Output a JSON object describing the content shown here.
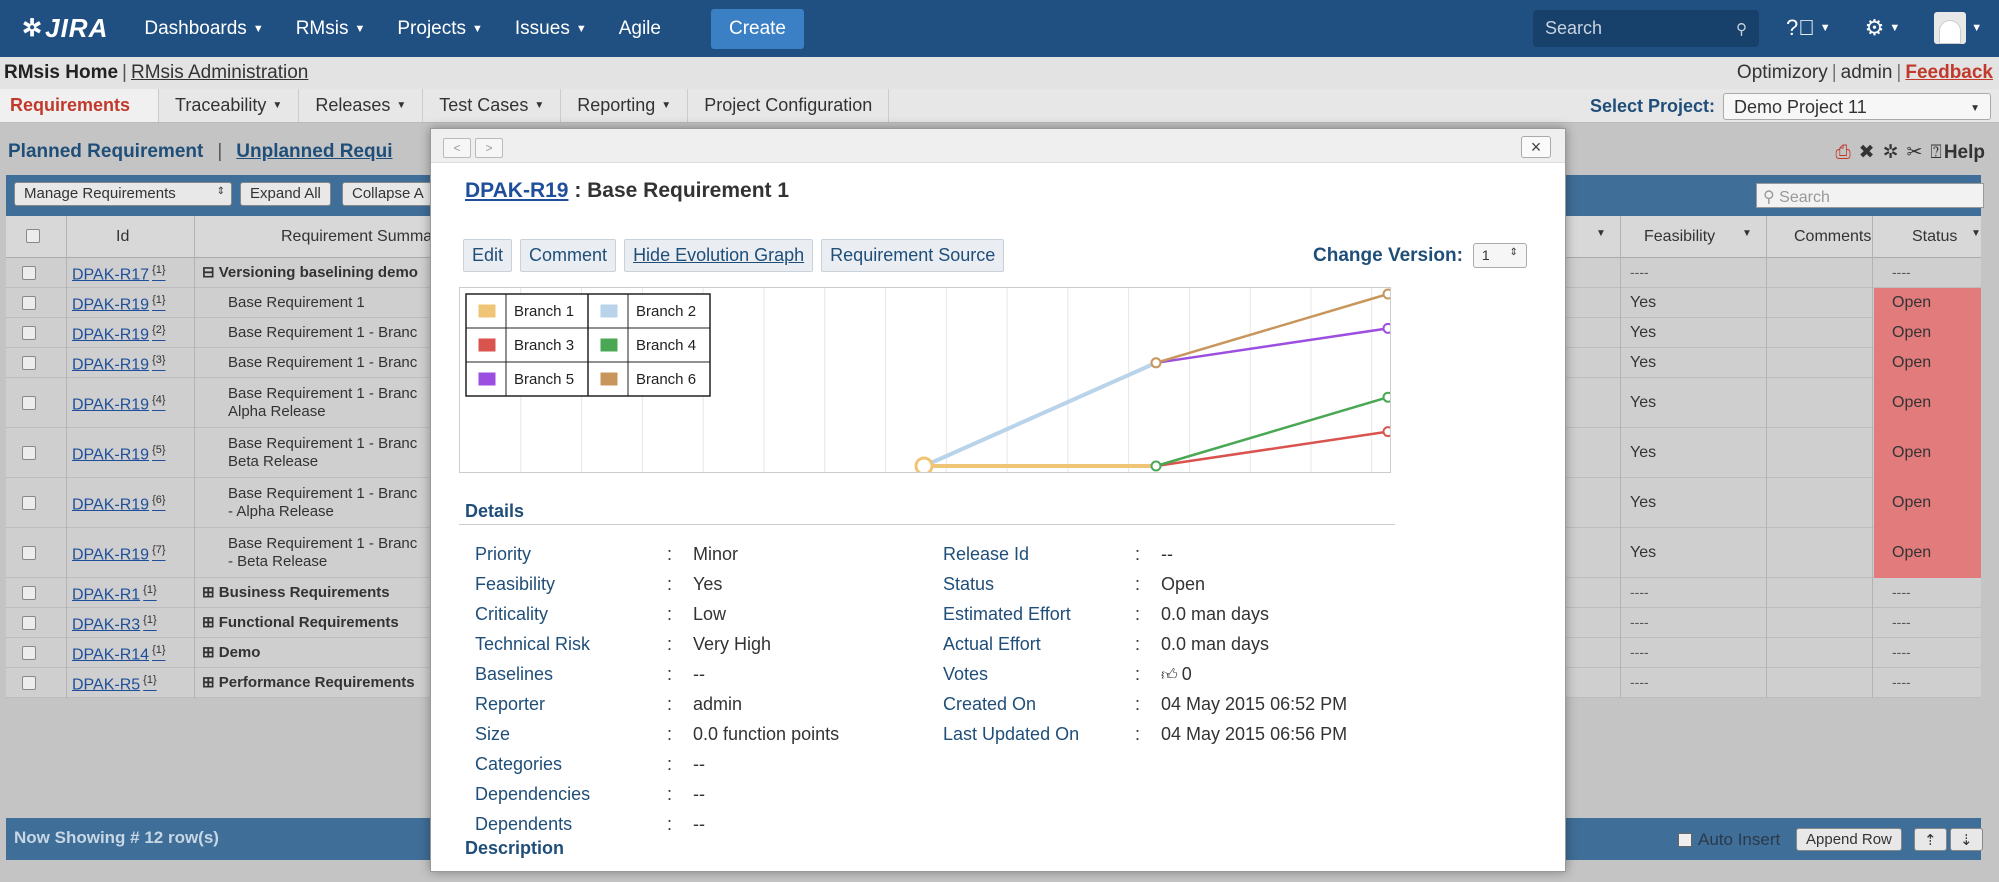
{
  "topbar": {
    "logo": "JIRA",
    "nav": [
      "Dashboards",
      "RMsis",
      "Projects",
      "Issues",
      "Agile"
    ],
    "create": "Create",
    "search_placeholder": "Search"
  },
  "rmhead": {
    "home": "RMsis Home",
    "admin": "RMsis Administration",
    "right": [
      "Optimizory",
      "admin",
      "Feedback"
    ]
  },
  "tabs": [
    "Requirements",
    "Traceability",
    "Releases",
    "Test Cases",
    "Reporting",
    "Project Configuration"
  ],
  "select_project": {
    "label": "Select Project:",
    "value": "Demo Project 11"
  },
  "background": {
    "planned": "Planned Requirement",
    "unplanned": "Unplanned Requi",
    "separator": "|",
    "help": "Help",
    "buttons": [
      "Manage Requirements",
      "Expand All",
      "Collapse A"
    ],
    "search_placeholder": "Search",
    "headers": [
      "Id",
      "Requirement Summa",
      "Feasibility",
      "Comments",
      "Status"
    ],
    "rows": [
      {
        "id": "DPAK-R17",
        "ver": "{1}",
        "summary": "⊟ Versioning baselining demo",
        "bold": true,
        "feas": "----",
        "status": "----"
      },
      {
        "id": "DPAK-R19",
        "ver": "{1}",
        "summary": "Base Requirement 1",
        "bold": false,
        "feas": "Yes",
        "status": "Open"
      },
      {
        "id": "DPAK-R19",
        "ver": "{2}",
        "summary": "Base Requirement 1 - Branc",
        "bold": false,
        "feas": "Yes",
        "status": "Open"
      },
      {
        "id": "DPAK-R19",
        "ver": "{3}",
        "summary": "Base Requirement 1 - Branc",
        "bold": false,
        "feas": "Yes",
        "status": "Open"
      },
      {
        "id": "DPAK-R19",
        "ver": "{4}",
        "summary": "Base Requirement 1 - Branc",
        "summary2": "Alpha Release",
        "bold": false,
        "feas": "Yes",
        "status": "Open"
      },
      {
        "id": "DPAK-R19",
        "ver": "{5}",
        "summary": "Base Requirement 1 - Branc",
        "summary2": "Beta Release",
        "bold": false,
        "feas": "Yes",
        "status": "Open"
      },
      {
        "id": "DPAK-R19",
        "ver": "{6}",
        "summary": "Base Requirement 1 - Branc",
        "summary2": "- Alpha Release",
        "bold": false,
        "feas": "Yes",
        "status": "Open"
      },
      {
        "id": "DPAK-R19",
        "ver": "{7}",
        "summary": "Base Requirement 1 - Branc",
        "summary2": "- Beta Release",
        "bold": false,
        "feas": "Yes",
        "status": "Open"
      },
      {
        "id": "DPAK-R1",
        "ver": "{1}",
        "summary": "⊞ Business Requirements",
        "bold": true,
        "feas": "----",
        "status": "----"
      },
      {
        "id": "DPAK-R3",
        "ver": "{1}",
        "summary": "⊞ Functional Requirements",
        "bold": true,
        "feas": "----",
        "status": "----"
      },
      {
        "id": "DPAK-R14",
        "ver": "{1}",
        "summary": "⊞ Demo",
        "bold": true,
        "feas": "----",
        "status": "----"
      },
      {
        "id": "DPAK-R5",
        "ver": "{1}",
        "summary": "⊞ Performance Requirements",
        "bold": true,
        "feas": "----",
        "status": "----"
      }
    ],
    "footer": "Now Showing # 12 row(s)",
    "auto_insert": "Auto Insert",
    "append_row": "Append Row"
  },
  "modal": {
    "req_id": "DPAK-R19",
    "req_title": ": Base Requirement 1",
    "buttons": [
      "Edit",
      "Comment",
      "Hide Evolution Graph",
      "Requirement Source"
    ],
    "change_version": {
      "label": "Change Version:",
      "value": "1"
    },
    "details_title": "Details",
    "description_title": "Description",
    "details_left": [
      {
        "label": "Priority",
        "value": "Minor"
      },
      {
        "label": "Feasibility",
        "value": "Yes"
      },
      {
        "label": "Criticality",
        "value": "Low"
      },
      {
        "label": "Technical Risk",
        "value": "Very High"
      },
      {
        "label": "Baselines",
        "value": "--"
      },
      {
        "label": "Reporter",
        "value": "admin"
      },
      {
        "label": "Size",
        "value": "0.0 function points"
      },
      {
        "label": "Categories",
        "value": "--"
      },
      {
        "label": "Dependencies",
        "value": "--"
      },
      {
        "label": "Dependents",
        "value": "--"
      }
    ],
    "details_right": [
      {
        "label": "Release Id",
        "value": "--"
      },
      {
        "label": "Status",
        "value": "Open"
      },
      {
        "label": "Estimated Effort",
        "value": "0.0 man days"
      },
      {
        "label": "Actual Effort",
        "value": "0.0 man days"
      },
      {
        "label": "Votes",
        "value": "0"
      },
      {
        "label": "Created On",
        "value": "04 May 2015 06:52 PM"
      },
      {
        "label": "Last Updated On",
        "value": "04 May 2015 06:56 PM"
      }
    ]
  },
  "chart_data": {
    "type": "line",
    "x": [
      0,
      1,
      2,
      3,
      4,
      5,
      6,
      7,
      8
    ],
    "xlim": [
      0,
      8
    ],
    "ylim": [
      0,
      10
    ],
    "grid": true,
    "legend_position": "top-left",
    "series": [
      {
        "name": "Branch 1",
        "color": "#f0c477",
        "points": [
          [
            4,
            0
          ],
          [
            6,
            0
          ]
        ]
      },
      {
        "name": "Branch 2",
        "color": "#b8d3ea",
        "points": [
          [
            4,
            0
          ],
          [
            6,
            6
          ]
        ]
      },
      {
        "name": "Branch 3",
        "color": "#d9534f",
        "points": [
          [
            6,
            0
          ],
          [
            8,
            2
          ]
        ]
      },
      {
        "name": "Branch 4",
        "color": "#4aa855",
        "points": [
          [
            6,
            0
          ],
          [
            8,
            4
          ]
        ]
      },
      {
        "name": "Branch 5",
        "color": "#9b4ee0",
        "points": [
          [
            6,
            6
          ],
          [
            8,
            8
          ]
        ]
      },
      {
        "name": "Branch 6",
        "color": "#c8965c",
        "points": [
          [
            6,
            6
          ],
          [
            8,
            10
          ]
        ]
      }
    ]
  }
}
